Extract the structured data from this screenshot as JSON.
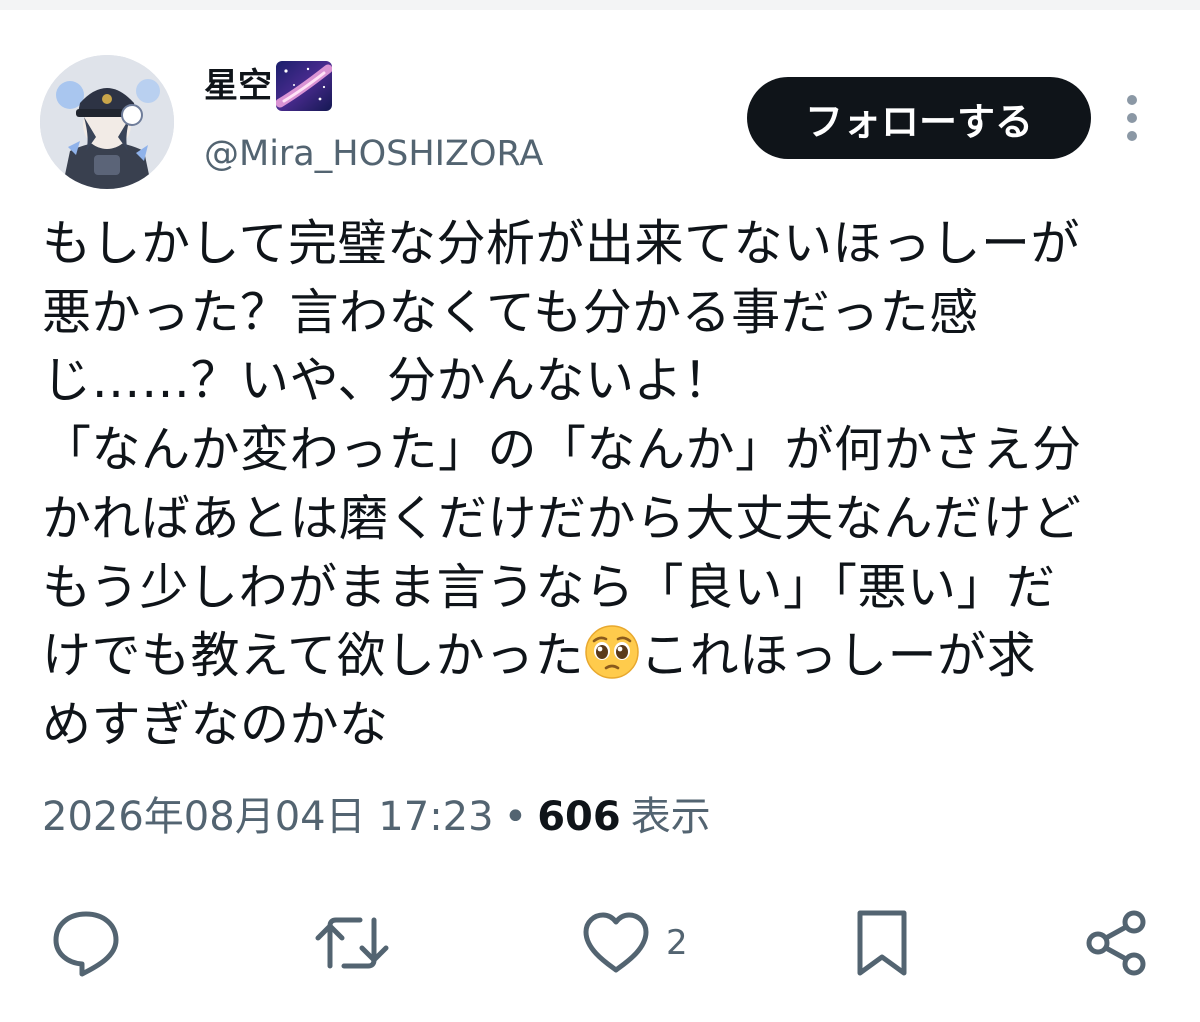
{
  "user": {
    "display_name": "星空",
    "name_emoji": "milky-way-emoji",
    "handle": "@Mira_HOSHIZORA",
    "avatar": "avatar-image"
  },
  "actions_top": {
    "follow_label": "フォローする",
    "more_icon": "more-vertical-icon"
  },
  "tweet": {
    "text_before_emoji": "もしかして完璧な分析が出来てないほっしーが\n悪かった？言わなくても分かる事だった感\nじ……？いや、分かんないよ！\n「なんか変わった」の「なんか」が何かさえ分\nかればあとは磨くだけだから大丈夫なんだけど\nもう少しわがまま言うなら「良い」「悪い」だ\nけでも教えて欲しかった",
    "emoji": "pleading-face-emoji",
    "text_after_emoji": "これほっしーが求\nめすぎなのかな"
  },
  "meta": {
    "timestamp": "2026年08月04日 17:23",
    "separator": "•",
    "views_count": "606",
    "views_label": "表示"
  },
  "engagement": {
    "reply_icon": "reply-icon",
    "retweet_icon": "retweet-icon",
    "like_icon": "like-heart-icon",
    "like_count": "2",
    "bookmark_icon": "bookmark-icon",
    "share_icon": "share-icon"
  },
  "colors": {
    "text_primary": "#0f1419",
    "text_secondary": "#536471",
    "follow_bg": "#0f1419",
    "follow_text": "#ffffff",
    "background": "#ffffff"
  }
}
